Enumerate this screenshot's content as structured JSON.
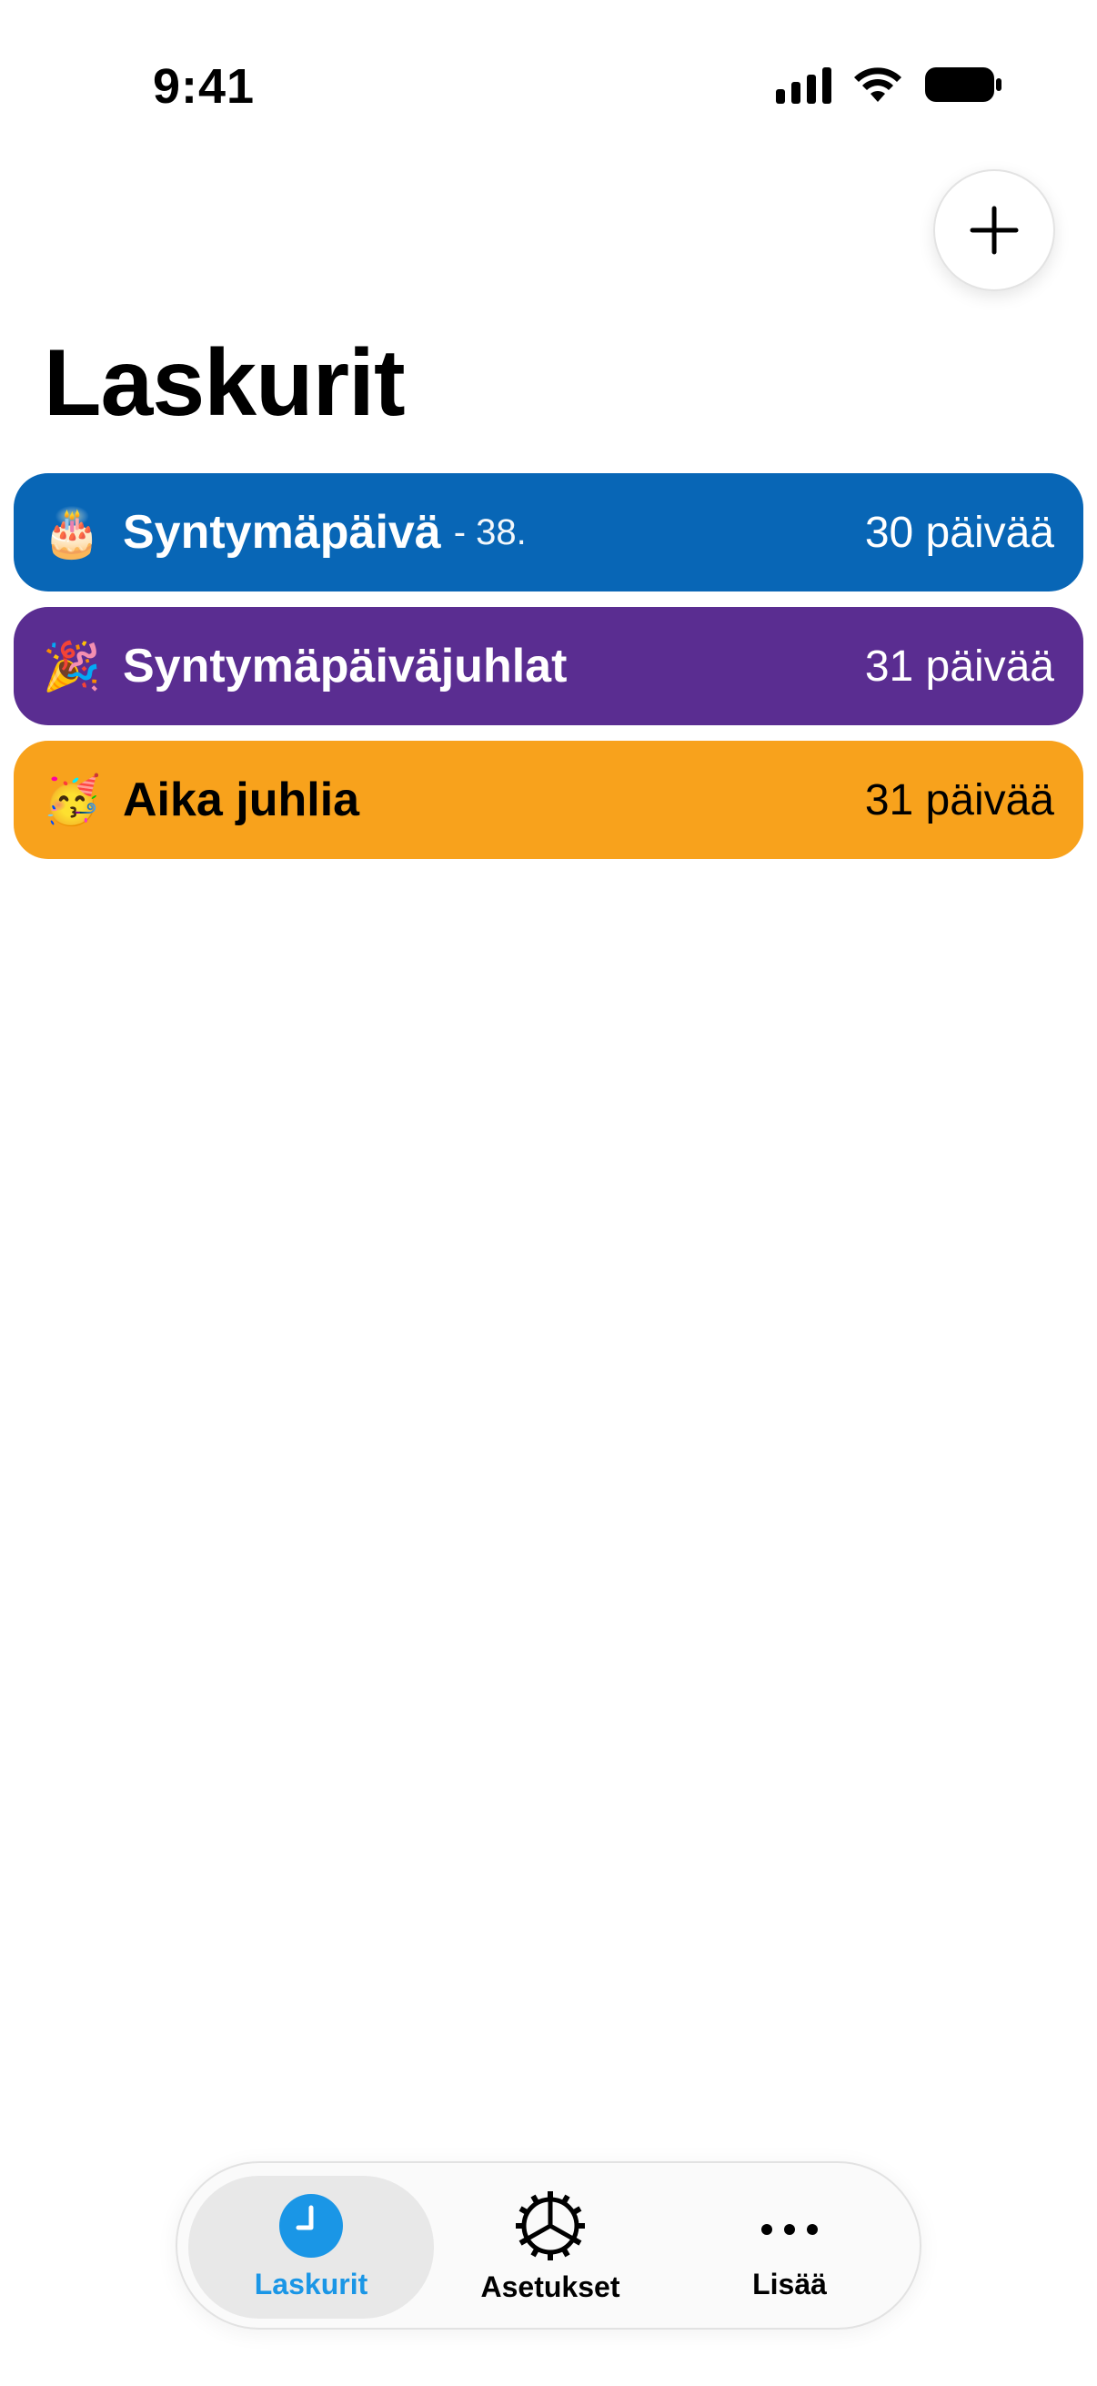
{
  "status_bar": {
    "time": "9:41"
  },
  "header": {
    "title": "Laskurit",
    "add_icon": "plus-icon"
  },
  "counters": [
    {
      "emoji": "🎂",
      "name": "Syntymäpäivä",
      "sub": "- 38.",
      "days": "30 päivää",
      "color": "#0866b6",
      "text_color": "#ffffff"
    },
    {
      "emoji": "🎉",
      "name": "Syntymäpäiväjuhlat",
      "sub": "",
      "days": "31 päivää",
      "color": "#5a2d91",
      "text_color": "#ffffff"
    },
    {
      "emoji": "🥳",
      "name": "Aika juhlia",
      "sub": "",
      "days": "31 päivää",
      "color": "#f8a21c",
      "text_color": "#000000"
    }
  ],
  "tab_bar": {
    "tabs": [
      {
        "label": "Laskurit",
        "icon": "clock-icon",
        "active": true
      },
      {
        "label": "Asetukset",
        "icon": "gear-icon",
        "active": false
      },
      {
        "label": "Lisää",
        "icon": "more-icon",
        "active": false
      }
    ],
    "accent": "#1a96e6"
  }
}
